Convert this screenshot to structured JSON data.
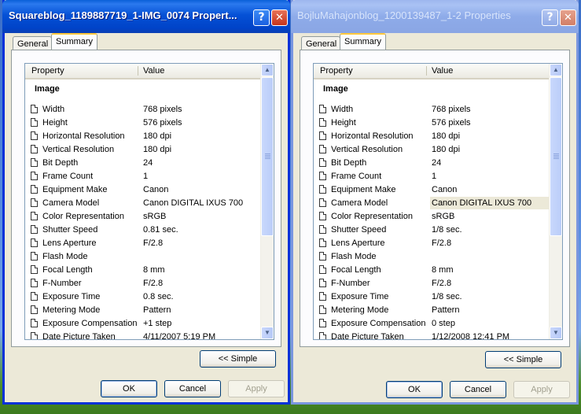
{
  "windows": [
    {
      "title": "Squareblog_1189887719_1-IMG_0074 Propert...",
      "help_label": "?",
      "close_label": "✕",
      "tabs": [
        "General",
        "Summary"
      ],
      "columns": {
        "property": "Property",
        "value": "Value"
      },
      "group_title": "Image",
      "rows": [
        {
          "property": "Width",
          "value": "768 pixels"
        },
        {
          "property": "Height",
          "value": "576 pixels"
        },
        {
          "property": "Horizontal Resolution",
          "value": "180 dpi"
        },
        {
          "property": "Vertical Resolution",
          "value": "180 dpi"
        },
        {
          "property": "Bit Depth",
          "value": "24"
        },
        {
          "property": "Frame Count",
          "value": "1"
        },
        {
          "property": "Equipment Make",
          "value": "Canon"
        },
        {
          "property": "Camera Model",
          "value": "Canon DIGITAL IXUS 700"
        },
        {
          "property": "Color Representation",
          "value": "sRGB"
        },
        {
          "property": "Shutter Speed",
          "value": "0.81 sec."
        },
        {
          "property": "Lens Aperture",
          "value": "F/2.8"
        },
        {
          "property": "Flash Mode",
          "value": ""
        },
        {
          "property": "Focal Length",
          "value": "8 mm"
        },
        {
          "property": "F-Number",
          "value": "F/2.8"
        },
        {
          "property": "Exposure Time",
          "value": "0.8 sec."
        },
        {
          "property": "Metering Mode",
          "value": "Pattern"
        },
        {
          "property": "Exposure Compensation",
          "value": "+1 step"
        },
        {
          "property": "Date Picture Taken",
          "value": "4/11/2007 5:19 PM"
        }
      ],
      "simple_label": "<< Simple",
      "ok_label": "OK",
      "cancel_label": "Cancel",
      "apply_label": "Apply"
    },
    {
      "title": "BojluMahajonblog_1200139487_1-2 Properties",
      "help_label": "?",
      "close_label": "✕",
      "tabs": [
        "General",
        "Summary"
      ],
      "columns": {
        "property": "Property",
        "value": "Value"
      },
      "group_title": "Image",
      "rows": [
        {
          "property": "Width",
          "value": "768 pixels"
        },
        {
          "property": "Height",
          "value": "576 pixels"
        },
        {
          "property": "Horizontal Resolution",
          "value": "180 dpi"
        },
        {
          "property": "Vertical Resolution",
          "value": "180 dpi"
        },
        {
          "property": "Bit Depth",
          "value": "24"
        },
        {
          "property": "Frame Count",
          "value": "1"
        },
        {
          "property": "Equipment Make",
          "value": "Canon"
        },
        {
          "property": "Camera Model",
          "value": "Canon DIGITAL IXUS 700"
        },
        {
          "property": "Color Representation",
          "value": "sRGB"
        },
        {
          "property": "Shutter Speed",
          "value": "1/8 sec."
        },
        {
          "property": "Lens Aperture",
          "value": "F/2.8"
        },
        {
          "property": "Flash Mode",
          "value": ""
        },
        {
          "property": "Focal Length",
          "value": "8 mm"
        },
        {
          "property": "F-Number",
          "value": "F/2.8"
        },
        {
          "property": "Exposure Time",
          "value": "1/8 sec."
        },
        {
          "property": "Metering Mode",
          "value": "Pattern"
        },
        {
          "property": "Exposure Compensation",
          "value": "0 step"
        },
        {
          "property": "Date Picture Taken",
          "value": "1/12/2008 12:41 PM"
        }
      ],
      "selected_row": "Camera Model",
      "simple_label": "<< Simple",
      "ok_label": "OK",
      "cancel_label": "Cancel",
      "apply_label": "Apply"
    }
  ]
}
